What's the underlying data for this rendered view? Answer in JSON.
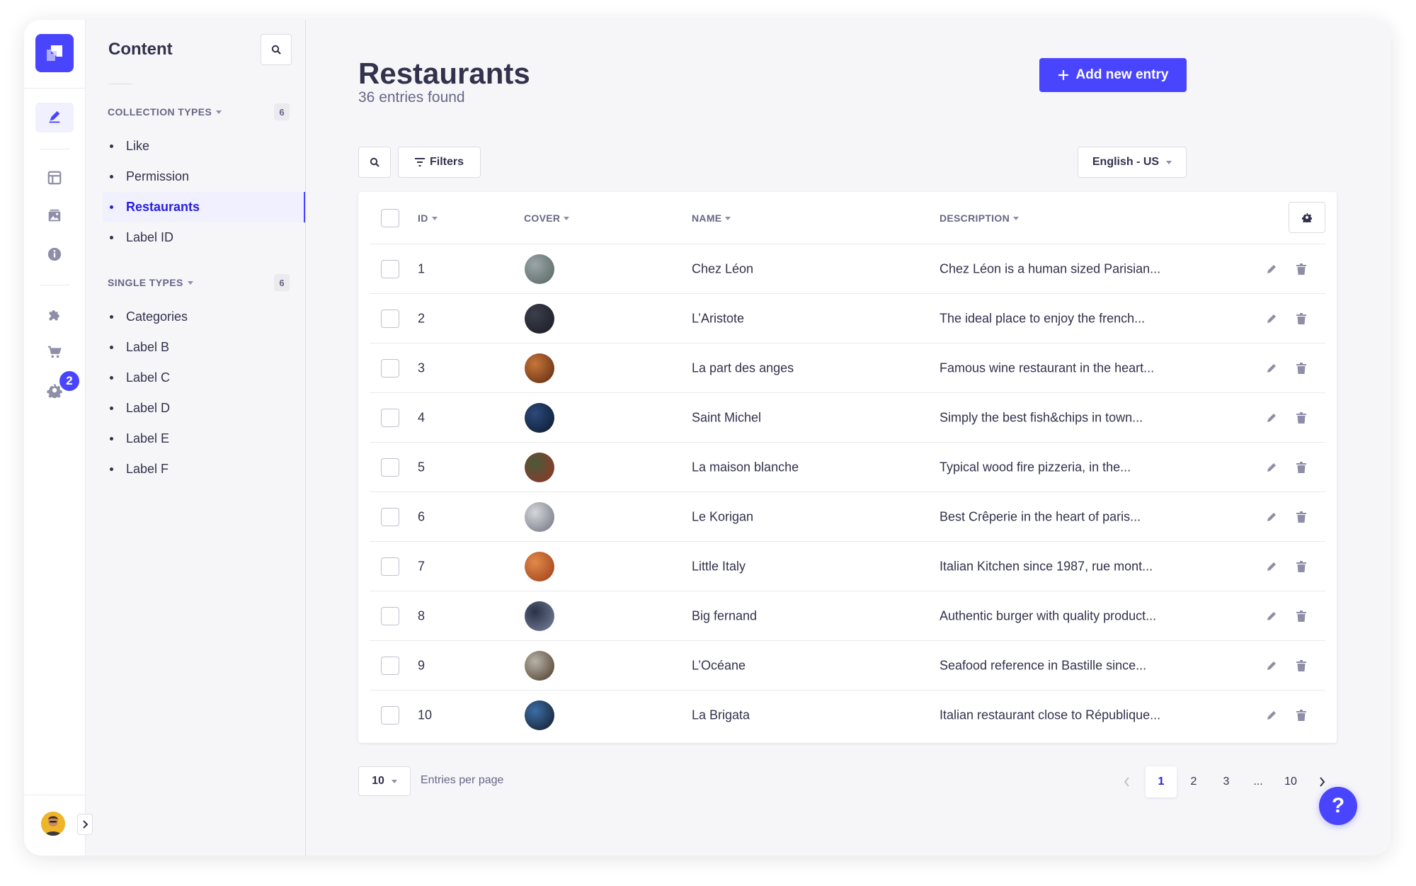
{
  "colors": {
    "primary": "#4945ff",
    "primary_text": "#271fe0",
    "text": "#32324d",
    "muted": "#666687"
  },
  "rail": {
    "items": [
      {
        "name": "content-manager-icon",
        "active": true
      },
      {
        "name": "content-type-builder-icon"
      },
      {
        "name": "media-library-icon"
      },
      {
        "name": "info-icon"
      },
      {
        "name": "plugins-icon"
      },
      {
        "name": "marketplace-icon"
      },
      {
        "name": "settings-icon"
      }
    ],
    "settings_badge": "2"
  },
  "subnav": {
    "title": "Content",
    "collection_types": {
      "label": "COLLECTION TYPES",
      "count": "6",
      "items": [
        "Like",
        "Permission",
        "Restaurants",
        "Label ID"
      ]
    },
    "single_types": {
      "label": "SINGLE TYPES",
      "count": "6",
      "items": [
        "Categories",
        "Label B",
        "Label C",
        "Label D",
        "Label E",
        "Label F"
      ]
    }
  },
  "header": {
    "title": "Restaurants",
    "subtitle": "36 entries found",
    "add_label": "Add new entry"
  },
  "toolbar": {
    "filters_label": "Filters",
    "locale": "English - US"
  },
  "table": {
    "columns": [
      "ID",
      "COVER",
      "NAME",
      "DESCRIPTION"
    ],
    "rows": [
      {
        "id": "1",
        "name": "Chez Léon",
        "description": "Chez Léon is a human sized Parisian...",
        "cover": [
          "#9aa5a8",
          "#5f6e6a"
        ]
      },
      {
        "id": "2",
        "name": "L’Aristote",
        "description": "The ideal place to enjoy the french...",
        "cover": [
          "#3b3f4c",
          "#1e2029"
        ]
      },
      {
        "id": "3",
        "name": "La part des anges",
        "description": "Famous wine restaurant in the heart...",
        "cover": [
          "#c8763a",
          "#6b3316"
        ]
      },
      {
        "id": "4",
        "name": "Saint Michel",
        "description": "Simply the best fish&chips in town...",
        "cover": [
          "#2c4a7a",
          "#0f1f3a"
        ]
      },
      {
        "id": "5",
        "name": "La maison blanche",
        "description": "Typical wood fire pizzeria, in the...",
        "cover": [
          "#4a5a3a",
          "#8a3a2a"
        ]
      },
      {
        "id": "6",
        "name": "Le Korigan",
        "description": "Best Crêperie in the heart of paris...",
        "cover": [
          "#d5d7dc",
          "#7c808a"
        ]
      },
      {
        "id": "7",
        "name": "Little Italy",
        "description": "Italian Kitchen since 1987, rue mont...",
        "cover": [
          "#e08a4a",
          "#a8471f"
        ]
      },
      {
        "id": "8",
        "name": "Big fernand",
        "description": "Authentic burger with quality product...",
        "cover": [
          "#2a3246",
          "#6e7893"
        ]
      },
      {
        "id": "9",
        "name": "L’Océane",
        "description": "Seafood reference in Bastille since...",
        "cover": [
          "#b7b3a8",
          "#5a4a3a"
        ]
      },
      {
        "id": "10",
        "name": "La Brigata",
        "description": "Italian restaurant close to République...",
        "cover": [
          "#3b6ea8",
          "#1a2638"
        ]
      }
    ]
  },
  "pagination": {
    "per_page": "10",
    "per_page_label": "Entries per page",
    "pages": [
      "1",
      "2",
      "3",
      "...",
      "10"
    ],
    "current": "1"
  },
  "help_label": "?"
}
